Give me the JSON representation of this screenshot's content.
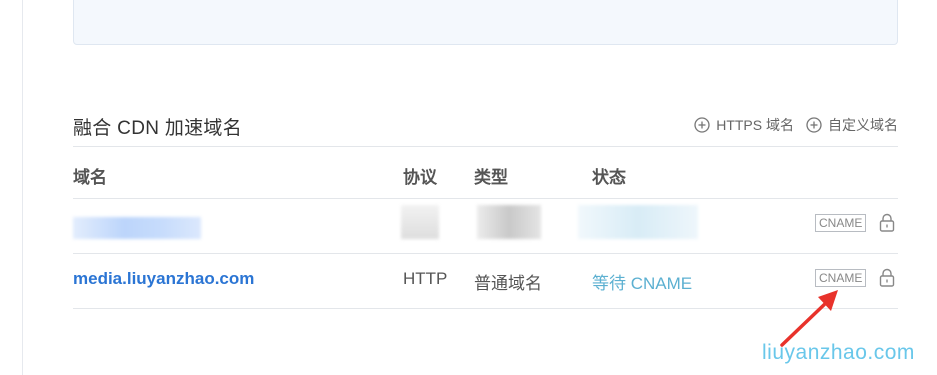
{
  "section": {
    "title": "融合 CDN 加速域名",
    "actions": {
      "https_label": "HTTPS 域名",
      "custom_label": "自定义域名"
    }
  },
  "table": {
    "headers": {
      "domain": "域名",
      "protocol": "协议",
      "type": "类型",
      "status": "状态"
    },
    "rows": [
      {
        "domain": "",
        "protocol": "",
        "type": "",
        "status": "",
        "tag": "CNAME"
      },
      {
        "domain": "media.liuyanzhao.com",
        "protocol": "HTTP",
        "type": "普通域名",
        "status": "等待 CNAME",
        "tag": "CNAME"
      }
    ]
  },
  "watermark": "liuyanzhao.com",
  "colors": {
    "link": "#2b75d4",
    "status": "#5cb0d1",
    "arrow": "#e8322b",
    "watermark": "#69c7ea"
  },
  "icons": {
    "add": "plus-circle-icon",
    "lock": "lock-icon"
  }
}
